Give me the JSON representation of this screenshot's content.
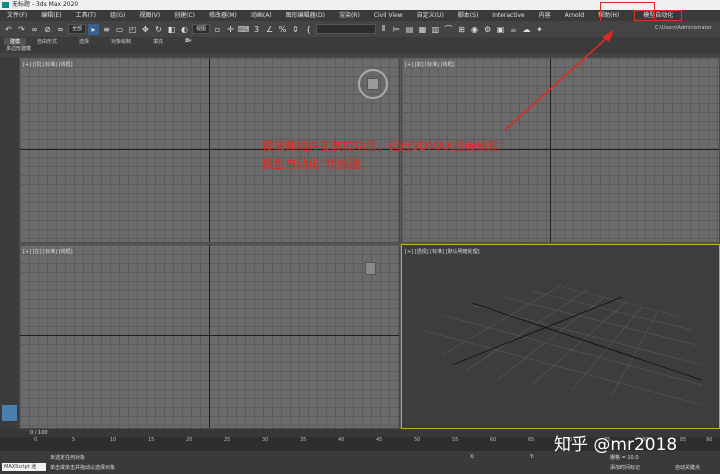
{
  "window": {
    "title": "无标题 - 3ds Max 2020"
  },
  "menu": [
    "文件(F)",
    "编辑(E)",
    "工具(T)",
    "组(G)",
    "视图(V)",
    "创建(C)",
    "修改器(M)",
    "动画(A)",
    "图形编辑器(D)",
    "渲染(R)",
    "Civil View",
    "自定义(U)",
    "脚本(S)",
    "Interactive",
    "内容",
    "Arnold",
    "帮助(H)",
    "模型自动化"
  ],
  "toolbar": {
    "selection_filter": "全部",
    "ref_coord": "视图",
    "path": "C:\\Users\\Administrator"
  },
  "ribbon": {
    "tabs": [
      "建模",
      "自由形式",
      "选择",
      "对象绘制",
      "填充"
    ],
    "sub_label": "多边形建模"
  },
  "viewports": {
    "top": "[+] [顶] [标准] [线框]",
    "front": "[+] [前] [标准] [线框]",
    "left": "[+] [左] [标准] [线框]",
    "persp": "[+] [透视] [标准] [默认明暗处理]"
  },
  "timeline": {
    "frame": "0 / 100",
    "ticks": [
      "0",
      "5",
      "10",
      "15",
      "20",
      "25",
      "30",
      "35",
      "40",
      "45",
      "50",
      "55",
      "60",
      "65",
      "70",
      "75",
      "80",
      "85",
      "90"
    ]
  },
  "status": {
    "maxscript": "MAXScript 迷",
    "line1": "未选定任何对象",
    "line2": "单击或单击并拖动以选择对象",
    "grid": "栅格 = 10.0",
    "add_key": "添加时间标记",
    "autokey": "自动关键点"
  },
  "annotation": {
    "line1": "模法师插件安装成功后，运行3DMAX后会出现“",
    "line2": "模型自动化”功能键。"
  },
  "watermark": "知乎 @mr2018"
}
